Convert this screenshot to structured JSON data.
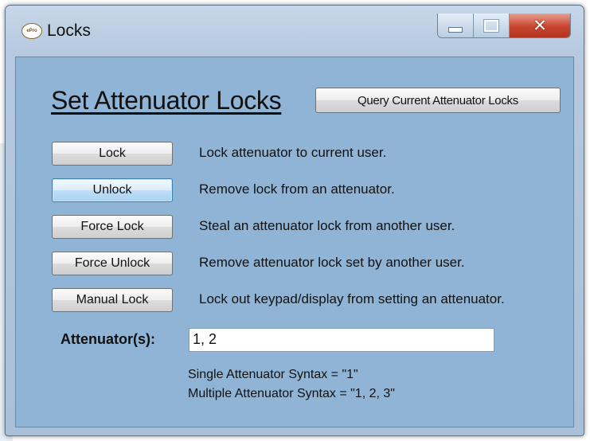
{
  "window": {
    "title": "Locks",
    "app_icon_text": "ePro"
  },
  "heading": "Set Attenuator Locks",
  "query_button": "Query Current Attenuator Locks",
  "rows": [
    {
      "button": "Lock",
      "description": "Lock attenuator to current user."
    },
    {
      "button": "Unlock",
      "description": "Remove lock from an attenuator."
    },
    {
      "button": "Force Lock",
      "description": "Steal an attenuator lock from another user."
    },
    {
      "button": "Force Unlock",
      "description": "Remove attenuator lock set by another user."
    },
    {
      "button": "Manual Lock",
      "description": "Lock out keypad/display from setting an attenuator."
    }
  ],
  "attenuators": {
    "label": "Attenuator(s):",
    "value": "1, 2"
  },
  "syntax": {
    "single": "Single Attenuator Syntax = \"1\"",
    "multiple": "Multiple Attenuator Syntax = \"1, 2, 3\""
  },
  "colors": {
    "client_bg": "#8fb4d6",
    "frame": "#b6c9df",
    "close_button": "#c8452e",
    "focused_button": "#bfdff7"
  }
}
